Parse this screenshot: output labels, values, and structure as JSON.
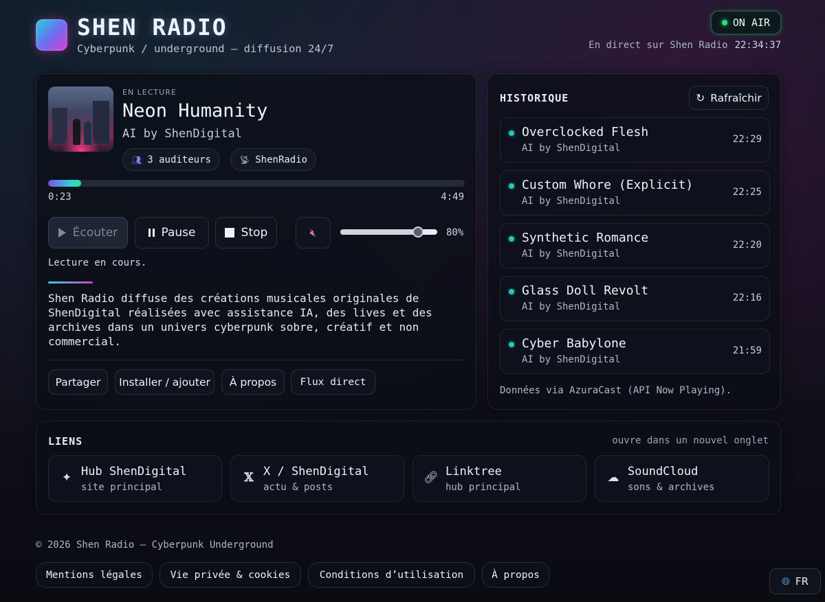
{
  "header": {
    "brand_title": "SHEN RADIO",
    "brand_subtitle": "Cyberpunk / underground — diffusion 24/7",
    "onair_label": "ON AIR",
    "direct_label": "En direct sur Shen Radio",
    "clock": "22:34:37"
  },
  "now_playing": {
    "label": "EN LECTURE",
    "title": "Neon Humanity",
    "artist": "AI by ShenDigital",
    "listeners": "3 auditeurs",
    "station": "ShenRadio",
    "elapsed": "0:23",
    "duration": "4:49",
    "progress_fraction": 0.08
  },
  "controls": {
    "listen_label": "Écouter",
    "pause_label": "Pause",
    "stop_label": "Stop",
    "volume_percent": 80,
    "volume_label": "80%",
    "status": "Lecture en cours."
  },
  "description": "Shen Radio diffuse des créations musicales originales de ShenDigital réalisées avec assistance IA, des lives et des archives dans un univers cyberpunk sobre, créatif et non commercial.",
  "player_buttons": {
    "share": "Partager",
    "install": "Installer / ajouter",
    "about": "À propos",
    "stream": "Flux direct"
  },
  "history": {
    "title": "HISTORIQUE",
    "refresh_label": "Rafraîchir",
    "items": [
      {
        "title": "Overclocked Flesh",
        "artist": "AI by ShenDigital",
        "time": "22:29"
      },
      {
        "title": "Custom Whore (Explicit)",
        "artist": "AI by ShenDigital",
        "time": "22:25"
      },
      {
        "title": "Synthetic Romance",
        "artist": "AI by ShenDigital",
        "time": "22:20"
      },
      {
        "title": "Glass Doll Revolt",
        "artist": "AI by ShenDigital",
        "time": "22:16"
      },
      {
        "title": "Cyber Babylone",
        "artist": "AI by ShenDigital",
        "time": "21:59"
      }
    ],
    "footer": "Données via AzuraCast (API Now Playing)."
  },
  "links": {
    "title": "LIENS",
    "note": "ouvre dans un nouvel onglet",
    "items": [
      {
        "name": "Hub ShenDigital",
        "sub": "site principal",
        "icon": "bird-icon"
      },
      {
        "name": "X / ShenDigital",
        "sub": "actu & posts",
        "icon": "x-icon"
      },
      {
        "name": "Linktree",
        "sub": "hub principal",
        "icon": "link-icon"
      },
      {
        "name": "SoundCloud",
        "sub": "sons & archives",
        "icon": "cloud-icon"
      }
    ]
  },
  "footer": {
    "copyright": "© 2026 Shen Radio — Cyberpunk Underground",
    "legal": "Mentions légales",
    "privacy": "Vie privée & cookies",
    "terms": "Conditions d’utilisation",
    "about": "À propos",
    "lang": "FR"
  },
  "colors": {
    "accent_cyan": "#2fd3d3",
    "accent_magenta": "#d23fd0",
    "onair_green": "#22e07a",
    "mute_pink": "#ff6a9a"
  }
}
